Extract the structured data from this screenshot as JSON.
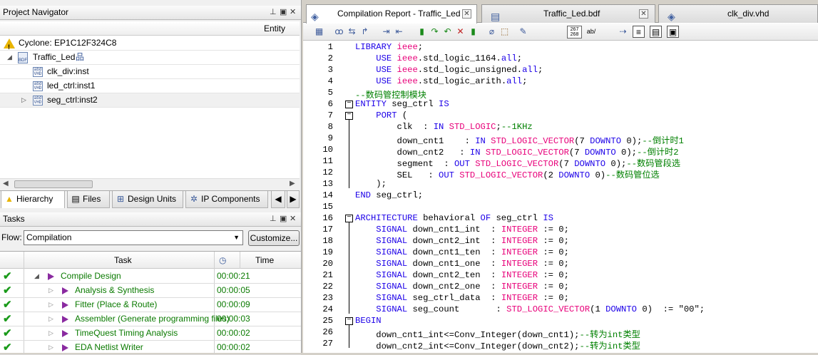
{
  "project_navigator": {
    "title": "Project Navigator",
    "entity_header": "Entity",
    "device": "Cyclone: EP1C12F324C8",
    "top": "Traffic_Led",
    "children": [
      "clk_div:inst",
      "led_ctrl:inst1",
      "seg_ctrl:inst2"
    ],
    "tabs": [
      "Hierarchy",
      "Files",
      "Design Units",
      "IP Components"
    ]
  },
  "tasks": {
    "title": "Tasks",
    "flow_label": "Flow:",
    "flow_value": "Compilation",
    "customize_label": "Customize...",
    "col_task": "Task",
    "col_time": "Time",
    "rows": [
      {
        "name": "Compile Design",
        "time": "00:00:21"
      },
      {
        "name": "Analysis & Synthesis",
        "time": "00:00:05"
      },
      {
        "name": "Fitter (Place & Route)",
        "time": "00:00:09"
      },
      {
        "name": "Assembler (Generate programming files)",
        "time": "00:00:03"
      },
      {
        "name": "TimeQuest Timing Analysis",
        "time": "00:00:02"
      },
      {
        "name": "EDA Netlist Writer",
        "time": "00:00:02"
      }
    ]
  },
  "doc_tabs": [
    "Compilation Report - Traffic_Led",
    "Traffic_Led.bdf",
    "clk_div.vhd"
  ],
  "toolbar": {
    "line_counter": "267\n268",
    "ab_label": "ab/"
  },
  "code_lines": [
    [
      [
        "kw",
        "LIBRARY "
      ],
      [
        "ty",
        "ieee"
      ],
      [
        "",
        "; "
      ]
    ],
    [
      [
        "",
        "    "
      ],
      [
        "kw",
        "USE "
      ],
      [
        "ty",
        "ieee"
      ],
      [
        "",
        ".std_logic_1164."
      ],
      [
        "kw",
        "all"
      ],
      [
        "",
        ";"
      ]
    ],
    [
      [
        "",
        "    "
      ],
      [
        "kw",
        "USE "
      ],
      [
        "ty",
        "ieee"
      ],
      [
        "",
        ".std_logic_unsigned."
      ],
      [
        "kw",
        "all"
      ],
      [
        "",
        ";"
      ]
    ],
    [
      [
        "",
        "    "
      ],
      [
        "kw",
        "USE "
      ],
      [
        "ty",
        "ieee"
      ],
      [
        "",
        ".std_logic_arith."
      ],
      [
        "kw",
        "all"
      ],
      [
        "",
        ";"
      ]
    ],
    [
      [
        "cm",
        "--数码管控制模块"
      ]
    ],
    [
      [
        "kw",
        "ENTITY "
      ],
      [
        "",
        "seg_ctrl "
      ],
      [
        "kw",
        "IS"
      ]
    ],
    [
      [
        "",
        "    "
      ],
      [
        "kw",
        "PORT "
      ],
      [
        "",
        "("
      ]
    ],
    [
      [
        "",
        "        clk  : "
      ],
      [
        "kw",
        "IN "
      ],
      [
        "ty",
        "STD_LOGIC"
      ],
      [
        "",
        ";"
      ],
      [
        "cm",
        "--1KHz"
      ]
    ],
    [
      [
        "",
        "        down_cnt1    : "
      ],
      [
        "kw",
        "IN "
      ],
      [
        "ty",
        "STD_LOGIC_VECTOR"
      ],
      [
        "",
        "(7 "
      ],
      [
        "kw",
        "DOWNTO "
      ],
      [
        "",
        "0);"
      ],
      [
        "cm",
        "--倒计时1"
      ]
    ],
    [
      [
        "",
        "        down_cnt2   : "
      ],
      [
        "kw",
        "IN "
      ],
      [
        "ty",
        "STD_LOGIC_VECTOR"
      ],
      [
        "",
        "(7 "
      ],
      [
        "kw",
        "DOWNTO "
      ],
      [
        "",
        "0);"
      ],
      [
        "cm",
        "--倒计时2"
      ]
    ],
    [
      [
        "",
        "        segment  : "
      ],
      [
        "kw",
        "OUT "
      ],
      [
        "ty",
        "STD_LOGIC_VECTOR"
      ],
      [
        "",
        "(7 "
      ],
      [
        "kw",
        "DOWNTO "
      ],
      [
        "",
        "0);"
      ],
      [
        "cm",
        "--数码管段选"
      ]
    ],
    [
      [
        "",
        "        SEL   : "
      ],
      [
        "kw",
        "OUT "
      ],
      [
        "ty",
        "STD_LOGIC_VECTOR"
      ],
      [
        "",
        "(2 "
      ],
      [
        "kw",
        "DOWNTO "
      ],
      [
        "",
        "0)"
      ],
      [
        "cm",
        "--数码管位选"
      ]
    ],
    [
      [
        "",
        "    );"
      ]
    ],
    [
      [
        "kw",
        "END "
      ],
      [
        "",
        "seg_ctrl;"
      ]
    ],
    [
      [
        "",
        ""
      ]
    ],
    [
      [
        "kw",
        "ARCHITECTURE "
      ],
      [
        "",
        "behavioral "
      ],
      [
        "kw",
        "OF "
      ],
      [
        "",
        "seg_ctrl "
      ],
      [
        "kw",
        "IS"
      ]
    ],
    [
      [
        "",
        "    "
      ],
      [
        "kw",
        "SIGNAL "
      ],
      [
        "",
        "down_cnt1_int  : "
      ],
      [
        "ty",
        "INTEGER "
      ],
      [
        "",
        ":= 0;"
      ]
    ],
    [
      [
        "",
        "    "
      ],
      [
        "kw",
        "SIGNAL "
      ],
      [
        "",
        "down_cnt2_int  : "
      ],
      [
        "ty",
        "INTEGER "
      ],
      [
        "",
        ":= 0;"
      ]
    ],
    [
      [
        "",
        "    "
      ],
      [
        "kw",
        "SIGNAL "
      ],
      [
        "",
        "down_cnt1_ten  : "
      ],
      [
        "ty",
        "INTEGER "
      ],
      [
        "",
        ":= 0;"
      ]
    ],
    [
      [
        "",
        "    "
      ],
      [
        "kw",
        "SIGNAL "
      ],
      [
        "",
        "down_cnt1_one  : "
      ],
      [
        "ty",
        "INTEGER "
      ],
      [
        "",
        ":= 0;"
      ]
    ],
    [
      [
        "",
        "    "
      ],
      [
        "kw",
        "SIGNAL "
      ],
      [
        "",
        "down_cnt2_ten  : "
      ],
      [
        "ty",
        "INTEGER "
      ],
      [
        "",
        ":= 0;"
      ]
    ],
    [
      [
        "",
        "    "
      ],
      [
        "kw",
        "SIGNAL "
      ],
      [
        "",
        "down_cnt2_one  : "
      ],
      [
        "ty",
        "INTEGER "
      ],
      [
        "",
        ":= 0;"
      ]
    ],
    [
      [
        "",
        "    "
      ],
      [
        "kw",
        "SIGNAL "
      ],
      [
        "",
        "seg_ctrl_data  : "
      ],
      [
        "ty",
        "INTEGER "
      ],
      [
        "",
        ":= 0;"
      ]
    ],
    [
      [
        "",
        "    "
      ],
      [
        "kw",
        "SIGNAL "
      ],
      [
        "",
        "seg_count       : "
      ],
      [
        "ty",
        "STD_LOGIC_VECTOR"
      ],
      [
        "",
        "(1 "
      ],
      [
        "kw",
        "DOWNTO "
      ],
      [
        "",
        "0)  := \"00\";"
      ]
    ],
    [
      [
        "kw",
        "BEGIN"
      ]
    ],
    [
      [
        "",
        "    down_cnt1_int<=Conv_Integer(down_cnt1);"
      ],
      [
        "cm",
        "--转为int类型"
      ]
    ],
    [
      [
        "",
        "    down_cnt2_int<=Conv_Integer(down_cnt2);"
      ],
      [
        "cm",
        "--转为int类型"
      ]
    ]
  ],
  "folds": [
    6,
    7,
    16,
    25
  ]
}
